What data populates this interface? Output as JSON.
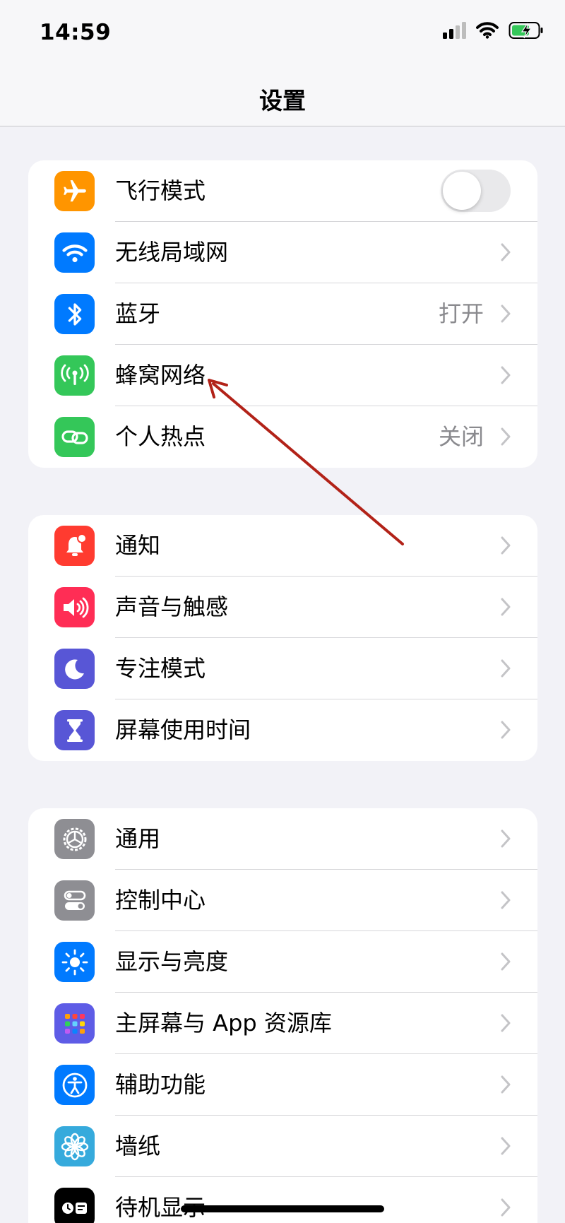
{
  "status_bar": {
    "time": "14:59",
    "battery_state": "charging"
  },
  "nav": {
    "title": "设置"
  },
  "groups": [
    {
      "rows": [
        {
          "label": "飞行模式",
          "icon": "airplane-icon",
          "icon_color": "#ff9500",
          "control": "toggle",
          "toggle_on": false
        },
        {
          "label": "无线局域网",
          "icon": "wifi-icon",
          "icon_color": "#007aff"
        },
        {
          "label": "蓝牙",
          "icon": "bluetooth-icon",
          "icon_color": "#007aff",
          "value": "打开"
        },
        {
          "label": "蜂窝网络",
          "icon": "cellular-icon",
          "icon_color": "#34c759"
        },
        {
          "label": "个人热点",
          "icon": "hotspot-icon",
          "icon_color": "#34c759",
          "value": "关闭"
        }
      ]
    },
    {
      "rows": [
        {
          "label": "通知",
          "icon": "notifications-icon",
          "icon_color": "#ff3b30"
        },
        {
          "label": "声音与触感",
          "icon": "sound-icon",
          "icon_color": "#ff2d55"
        },
        {
          "label": "专注模式",
          "icon": "moon-icon",
          "icon_color": "#5856d6"
        },
        {
          "label": "屏幕使用时间",
          "icon": "hourglass-icon",
          "icon_color": "#5856d6"
        }
      ]
    },
    {
      "rows": [
        {
          "label": "通用",
          "icon": "gear-icon",
          "icon_color": "#8e8e93"
        },
        {
          "label": "控制中心",
          "icon": "switches-icon",
          "icon_color": "#8e8e93"
        },
        {
          "label": "显示与亮度",
          "icon": "sun-icon",
          "icon_color": "#007aff"
        },
        {
          "label": "主屏幕与 App 资源库",
          "icon": "home-grid-icon",
          "icon_color": "#5e5ce6"
        },
        {
          "label": "辅助功能",
          "icon": "accessibility-icon",
          "icon_color": "#007aff"
        },
        {
          "label": "墙纸",
          "icon": "flower-icon",
          "icon_color": "#36aadc"
        },
        {
          "label": "待机显示",
          "icon": "standby-icon",
          "icon_color": "#000000"
        }
      ]
    }
  ],
  "annotation": {
    "color": "#b22218",
    "points_to": "蜂窝网络"
  }
}
